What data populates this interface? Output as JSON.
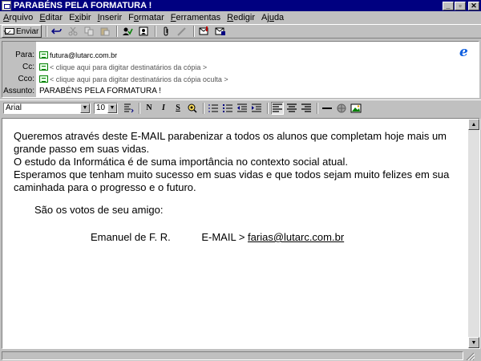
{
  "window": {
    "title": "PARABÉNS PELA FORMATURA !",
    "buttons": {
      "minimize": "_",
      "maximize": "▫",
      "close": "✕"
    }
  },
  "menu": [
    {
      "pre": "",
      "u": "A",
      "post": "rquivo"
    },
    {
      "pre": "",
      "u": "E",
      "post": "ditar"
    },
    {
      "pre": "E",
      "u": "x",
      "post": "ibir"
    },
    {
      "pre": "",
      "u": "I",
      "post": "nserir"
    },
    {
      "pre": "F",
      "u": "o",
      "post": "rmatar"
    },
    {
      "pre": "",
      "u": "F",
      "post": "erramentas"
    },
    {
      "pre": "",
      "u": "R",
      "post": "edigir"
    },
    {
      "pre": "Aj",
      "u": "u",
      "post": "da"
    }
  ],
  "toolbar": {
    "send_label": "Enviar"
  },
  "header": {
    "to_label": "Para:",
    "to_value": "futura@lutarc.com.br",
    "cc_label": "Cc:",
    "cc_hint": "< clique aqui para digitar destinatários da cópia >",
    "bcc_label": "Cco:",
    "bcc_hint": "< clique aqui para digitar destinatários da cópia oculta >",
    "subject_label": "Assunto:",
    "subject_value": "PARABÉNS PELA FORMATURA !",
    "logo_glyph": "e"
  },
  "format": {
    "font_name": "Arial",
    "font_size": "10",
    "bold": "N",
    "italic": "I",
    "underline": "S"
  },
  "message": {
    "line1": "Queremos através deste E-MAIL parabenizar a todos os alunos que completam hoje mais um grande passo em suas vidas.",
    "line2": "O estudo da Informática é de suma importância no contexto social atual.",
    "line3": "Esperamos que tenham muito sucesso em suas vidas e que todos sejam muito felizes em sua caminhada para o progresso e o futuro.",
    "closing": "São os votos de seu amigo:",
    "sender_name": "Emanuel de F. R.",
    "email_label": "E-MAIL >",
    "email_link": "farias@lutarc.com.br"
  },
  "colors": {
    "titlebar": "#000080",
    "window": "#c0c0c0",
    "ie_logo": "#1060e0"
  }
}
